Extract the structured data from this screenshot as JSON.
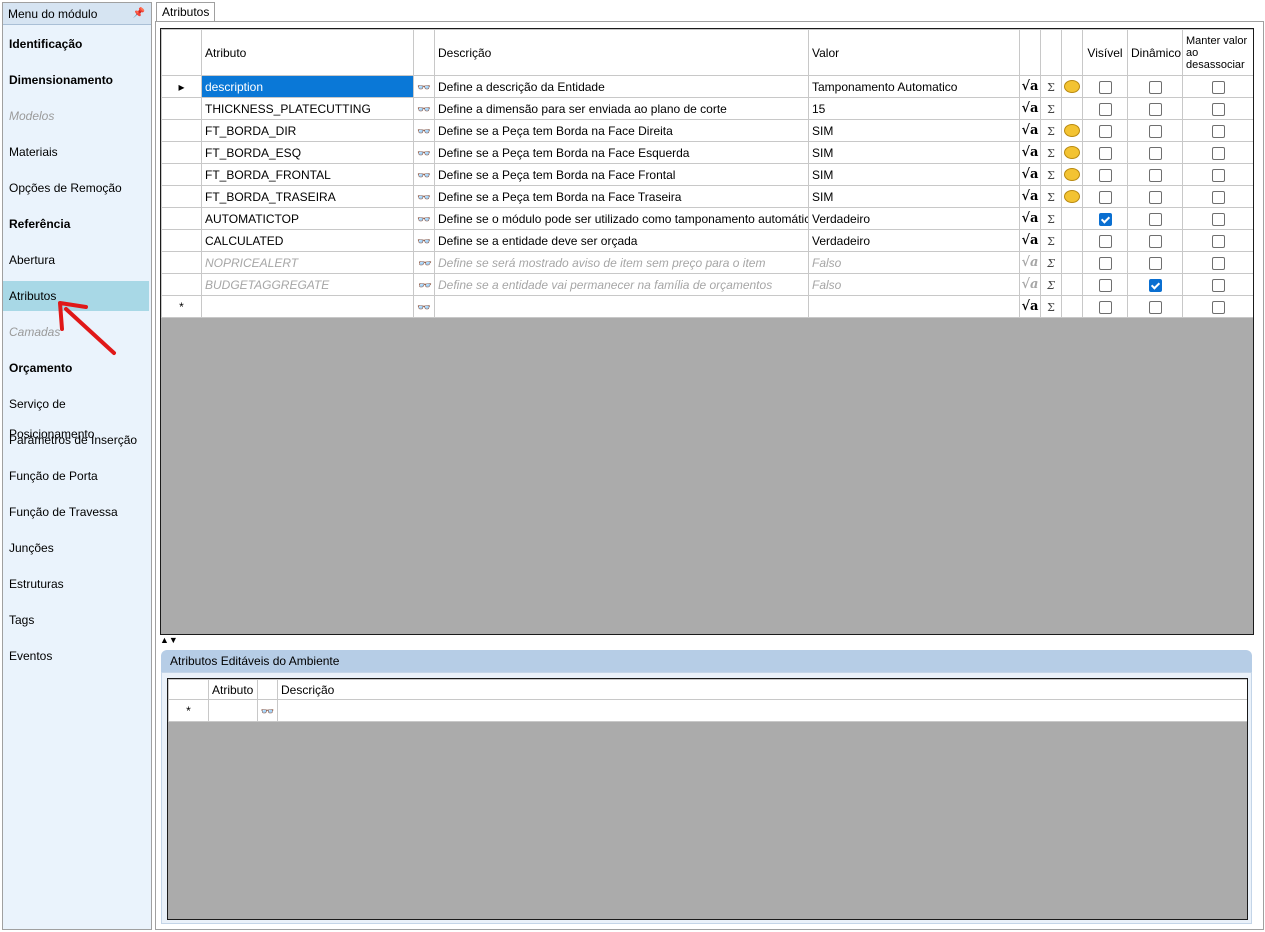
{
  "sidebar": {
    "title": "Menu do módulo",
    "pin_icon": "pin-icon",
    "items": [
      {
        "label": "Identificação",
        "style": "bold"
      },
      {
        "label": "Dimensionamento",
        "style": "bold"
      },
      {
        "label": "Modelos",
        "style": "disabled"
      },
      {
        "label": "Materiais",
        "style": "normal"
      },
      {
        "label": "Opções de Remoção",
        "style": "normal"
      },
      {
        "label": "Referência",
        "style": "bold"
      },
      {
        "label": "Abertura",
        "style": "normal"
      },
      {
        "label": "Atributos",
        "style": "selected"
      },
      {
        "label": "Camadas",
        "style": "disabled"
      },
      {
        "label": "Orçamento",
        "style": "bold"
      },
      {
        "label": "Serviço de Posicionamento",
        "style": "normal"
      },
      {
        "label": "Parâmetros de Inserção",
        "style": "normal"
      },
      {
        "label": "Função de Porta",
        "style": "normal"
      },
      {
        "label": "Função de Travessa",
        "style": "normal"
      },
      {
        "label": "Junções",
        "style": "normal"
      },
      {
        "label": "Estruturas",
        "style": "normal"
      },
      {
        "label": "Tags",
        "style": "normal"
      },
      {
        "label": "Eventos",
        "style": "normal"
      }
    ]
  },
  "tab": {
    "label": "Atributos"
  },
  "attributes_grid": {
    "columns": {
      "attribute": "Atributo",
      "description": "Descrição",
      "value": "Valor",
      "visible": "Visível",
      "dynamic": "Dinâmico",
      "keep": "Manter valor ao desassociar"
    },
    "rows": [
      {
        "attribute": "description",
        "description": "Define a descrição da Entidade",
        "value": "Tamponamento Automatico",
        "comment": true,
        "visible": false,
        "dynamic": false,
        "keep": false,
        "current": true,
        "dim": false
      },
      {
        "attribute": "THICKNESS_PLATECUTTING",
        "description": "Define a dimensão para ser enviada ao plano de corte",
        "value": "15",
        "comment": false,
        "visible": false,
        "dynamic": false,
        "keep": false,
        "current": false,
        "dim": false
      },
      {
        "attribute": "FT_BORDA_DIR",
        "description": "Define se a Peça tem Borda na Face Direita",
        "value": "SIM",
        "comment": true,
        "visible": false,
        "dynamic": false,
        "keep": false,
        "current": false,
        "dim": false
      },
      {
        "attribute": "FT_BORDA_ESQ",
        "description": "Define se a Peça tem Borda na Face Esquerda",
        "value": "SIM",
        "comment": true,
        "visible": false,
        "dynamic": false,
        "keep": false,
        "current": false,
        "dim": false
      },
      {
        "attribute": "FT_BORDA_FRONTAL",
        "description": "Define se a Peça tem Borda na Face Frontal",
        "value": "SIM",
        "comment": true,
        "visible": false,
        "dynamic": false,
        "keep": false,
        "current": false,
        "dim": false
      },
      {
        "attribute": "FT_BORDA_TRASEIRA",
        "description": "Define se a Peça tem Borda na Face Traseira",
        "value": "SIM",
        "comment": true,
        "visible": false,
        "dynamic": false,
        "keep": false,
        "current": false,
        "dim": false
      },
      {
        "attribute": "AUTOMATICTOP",
        "description": "Define se o módulo pode ser utilizado como tamponamento automático",
        "value": "Verdadeiro",
        "comment": false,
        "visible": true,
        "dynamic": false,
        "keep": false,
        "current": false,
        "dim": false
      },
      {
        "attribute": "CALCULATED",
        "description": "Define se a entidade deve ser orçada",
        "value": "Verdadeiro",
        "comment": false,
        "visible": false,
        "dynamic": false,
        "keep": false,
        "current": false,
        "dim": false
      },
      {
        "attribute": "NOPRICEALERT",
        "description": "Define se será mostrado aviso de item sem preço para o item",
        "value": "Falso",
        "comment": false,
        "visible": false,
        "dynamic": false,
        "keep": false,
        "current": false,
        "dim": true
      },
      {
        "attribute": "BUDGETAGGREGATE",
        "description": "Define se a entidade vai permanecer na família de orçamentos",
        "value": "Falso",
        "comment": false,
        "visible": false,
        "dynamic": true,
        "keep": false,
        "current": false,
        "dim": true
      }
    ],
    "new_row_marker": "*",
    "current_row_marker": "▸"
  },
  "splitter": {
    "glyph": "▲▼"
  },
  "ambient_group": {
    "title": "Atributos Editáveis do Ambiente",
    "columns": {
      "attribute": "Atributo",
      "description": "Descrição"
    },
    "new_row_marker": "*"
  },
  "icons": {
    "lookup": "binoculars-icon",
    "formula": "formula-icon",
    "sum": "sigma-icon",
    "comment": "comment-icon"
  }
}
